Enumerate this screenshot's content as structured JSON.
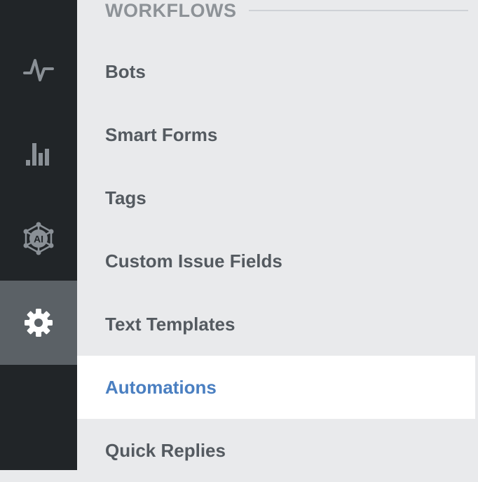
{
  "rail": {
    "items": [
      {
        "icon": "activity-pulse-icon",
        "active": false
      },
      {
        "icon": "bar-chart-icon",
        "active": false
      },
      {
        "icon": "ai-network-icon",
        "label": "AI",
        "active": false
      },
      {
        "icon": "gear-icon",
        "active": true
      }
    ]
  },
  "section": {
    "title": "WORKFLOWS"
  },
  "menu": {
    "items": [
      {
        "label": "Bots"
      },
      {
        "label": "Smart Forms"
      },
      {
        "label": "Tags"
      },
      {
        "label": "Custom Issue Fields"
      },
      {
        "label": "Text Templates"
      },
      {
        "label": "Automations",
        "selected": true
      },
      {
        "label": "Quick Replies"
      }
    ]
  },
  "colors": {
    "rail_bg": "#212528",
    "rail_active_bg": "#5b6166",
    "panel_bg": "#e9eaec",
    "selected_bg": "#ffffff",
    "selected_text": "#4a7fc1",
    "item_text": "#545a60",
    "section_title": "#8d9297",
    "icon": "#8a9096"
  }
}
